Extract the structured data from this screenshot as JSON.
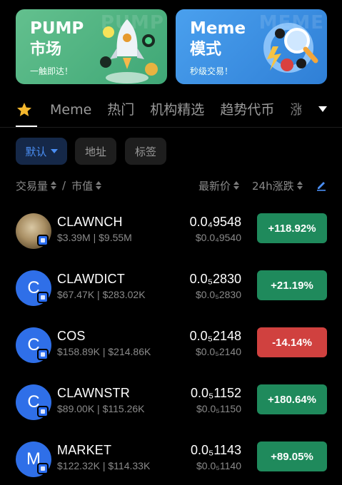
{
  "banners": {
    "pump": {
      "title": "PUMP",
      "title2": "市场",
      "subtitle": "一触即达！",
      "watermark": "PUMP"
    },
    "meme": {
      "title": "Meme",
      "title2": "模式",
      "subtitle": "秒级交易！",
      "watermark": "MEME"
    }
  },
  "tabs": {
    "favorites_icon": "star-icon",
    "items": [
      "Meme",
      "热门",
      "机构精选",
      "趋势代币",
      "涨"
    ],
    "more_icon": "chevron-down-icon"
  },
  "filters": {
    "default_label": "默认",
    "address_label": "地址",
    "tags_label": "标签"
  },
  "columns": {
    "volume": "交易量",
    "separator": "/",
    "market_cap": "市值",
    "latest_price": "最新价",
    "change_24h": "24h涨跌",
    "edit_icon": "pencil-icon"
  },
  "colors": {
    "up": "#1f8a5c",
    "down": "#d0413f",
    "accent": "#4a8ef3",
    "avatar_blue": "#2f6fe8"
  },
  "tokens": [
    {
      "symbol": "CLAWNCH",
      "avatar_letter": "",
      "volume": "$3.39M",
      "market_cap": "$9.55M",
      "price": "0.0₄9548",
      "price_usd": "$0.0₄9540",
      "change": "+118.92%",
      "direction": "up"
    },
    {
      "symbol": "CLAWDICT",
      "avatar_letter": "C",
      "volume": "$67.47K",
      "market_cap": "$283.02K",
      "price": "0.0₅2830",
      "price_usd": "$0.0₅2830",
      "change": "+21.19%",
      "direction": "up"
    },
    {
      "symbol": "COS",
      "avatar_letter": "C",
      "volume": "$158.89K",
      "market_cap": "$214.86K",
      "price": "0.0₅2148",
      "price_usd": "$0.0₅2140",
      "change": "-14.14%",
      "direction": "down"
    },
    {
      "symbol": "CLAWNSTR",
      "avatar_letter": "C",
      "volume": "$89.00K",
      "market_cap": "$115.26K",
      "price": "0.0₅1152",
      "price_usd": "$0.0₅1150",
      "change": "+180.64%",
      "direction": "up"
    },
    {
      "symbol": "MARKET",
      "avatar_letter": "M",
      "volume": "$122.32K",
      "market_cap": "$114.33K",
      "price": "0.0₅1143",
      "price_usd": "$0.0₅1140",
      "change": "+89.05%",
      "direction": "up"
    }
  ]
}
